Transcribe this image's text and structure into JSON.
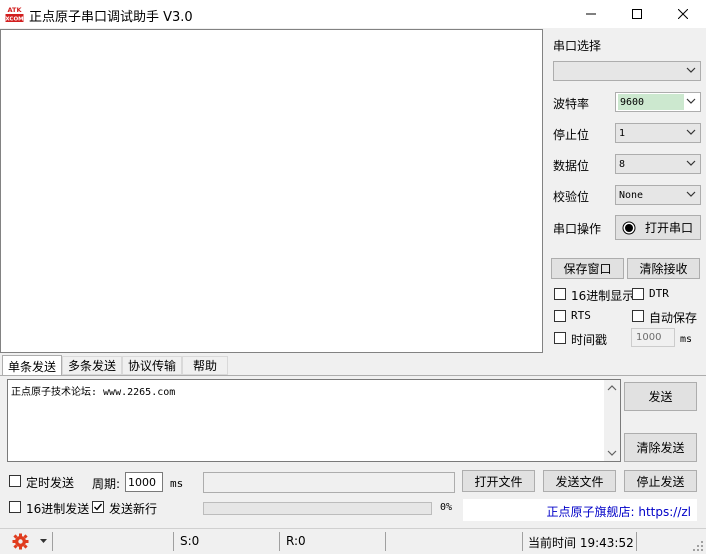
{
  "window": {
    "title": "正点原子串口调试助手 V3.0",
    "logo_text_top": "ATK",
    "logo_text_bottom": "XCOM"
  },
  "controls": {
    "minimize": "—",
    "maximize": "☐",
    "close": "✕"
  },
  "sidebar": {
    "port_label": "串口选择",
    "port_value": "",
    "baud_label": "波特率",
    "baud_value": "9600",
    "stop_label": "停止位",
    "stop_value": "1",
    "data_label": "数据位",
    "data_value": "8",
    "parity_label": "校验位",
    "parity_value": "None",
    "op_label": "串口操作",
    "open_port_button": "打开串口",
    "save_window_button": "保存窗口",
    "clear_receive_button": "清除接收",
    "hex_display_label": "16进制显示",
    "dtr_label": "DTR",
    "rts_label": "RTS",
    "auto_save_label": "自动保存",
    "timestamp_label": "时间戳",
    "timestamp_ms_value": "1000",
    "timestamp_unit": "ms"
  },
  "tabs": [
    "单条发送",
    "多条发送",
    "协议传输",
    "帮助"
  ],
  "send": {
    "text": "正点原子技术论坛: www.2265.com",
    "send_button": "发送",
    "clear_send_button": "清除发送",
    "timed_send_label": "定时发送",
    "period_label": "周期:",
    "period_value": "1000",
    "period_unit": "ms",
    "open_file_button": "打开文件",
    "send_file_button": "发送文件",
    "stop_send_button": "停止发送",
    "hex_send_label": "16进制发送",
    "newline_label": "发送新行",
    "newline_checked": true,
    "progress_text": "0%",
    "progress_fraction": 0,
    "flagship_link": "正点原子旗舰店: https://zl"
  },
  "status": {
    "s_count": "S:0",
    "r_count": "R:0",
    "time_label": "当前时间 19:43:52"
  },
  "colors": {
    "baud_highlight": "#cce8cf",
    "link": "#0000c8",
    "gear": "#e03c1e"
  }
}
